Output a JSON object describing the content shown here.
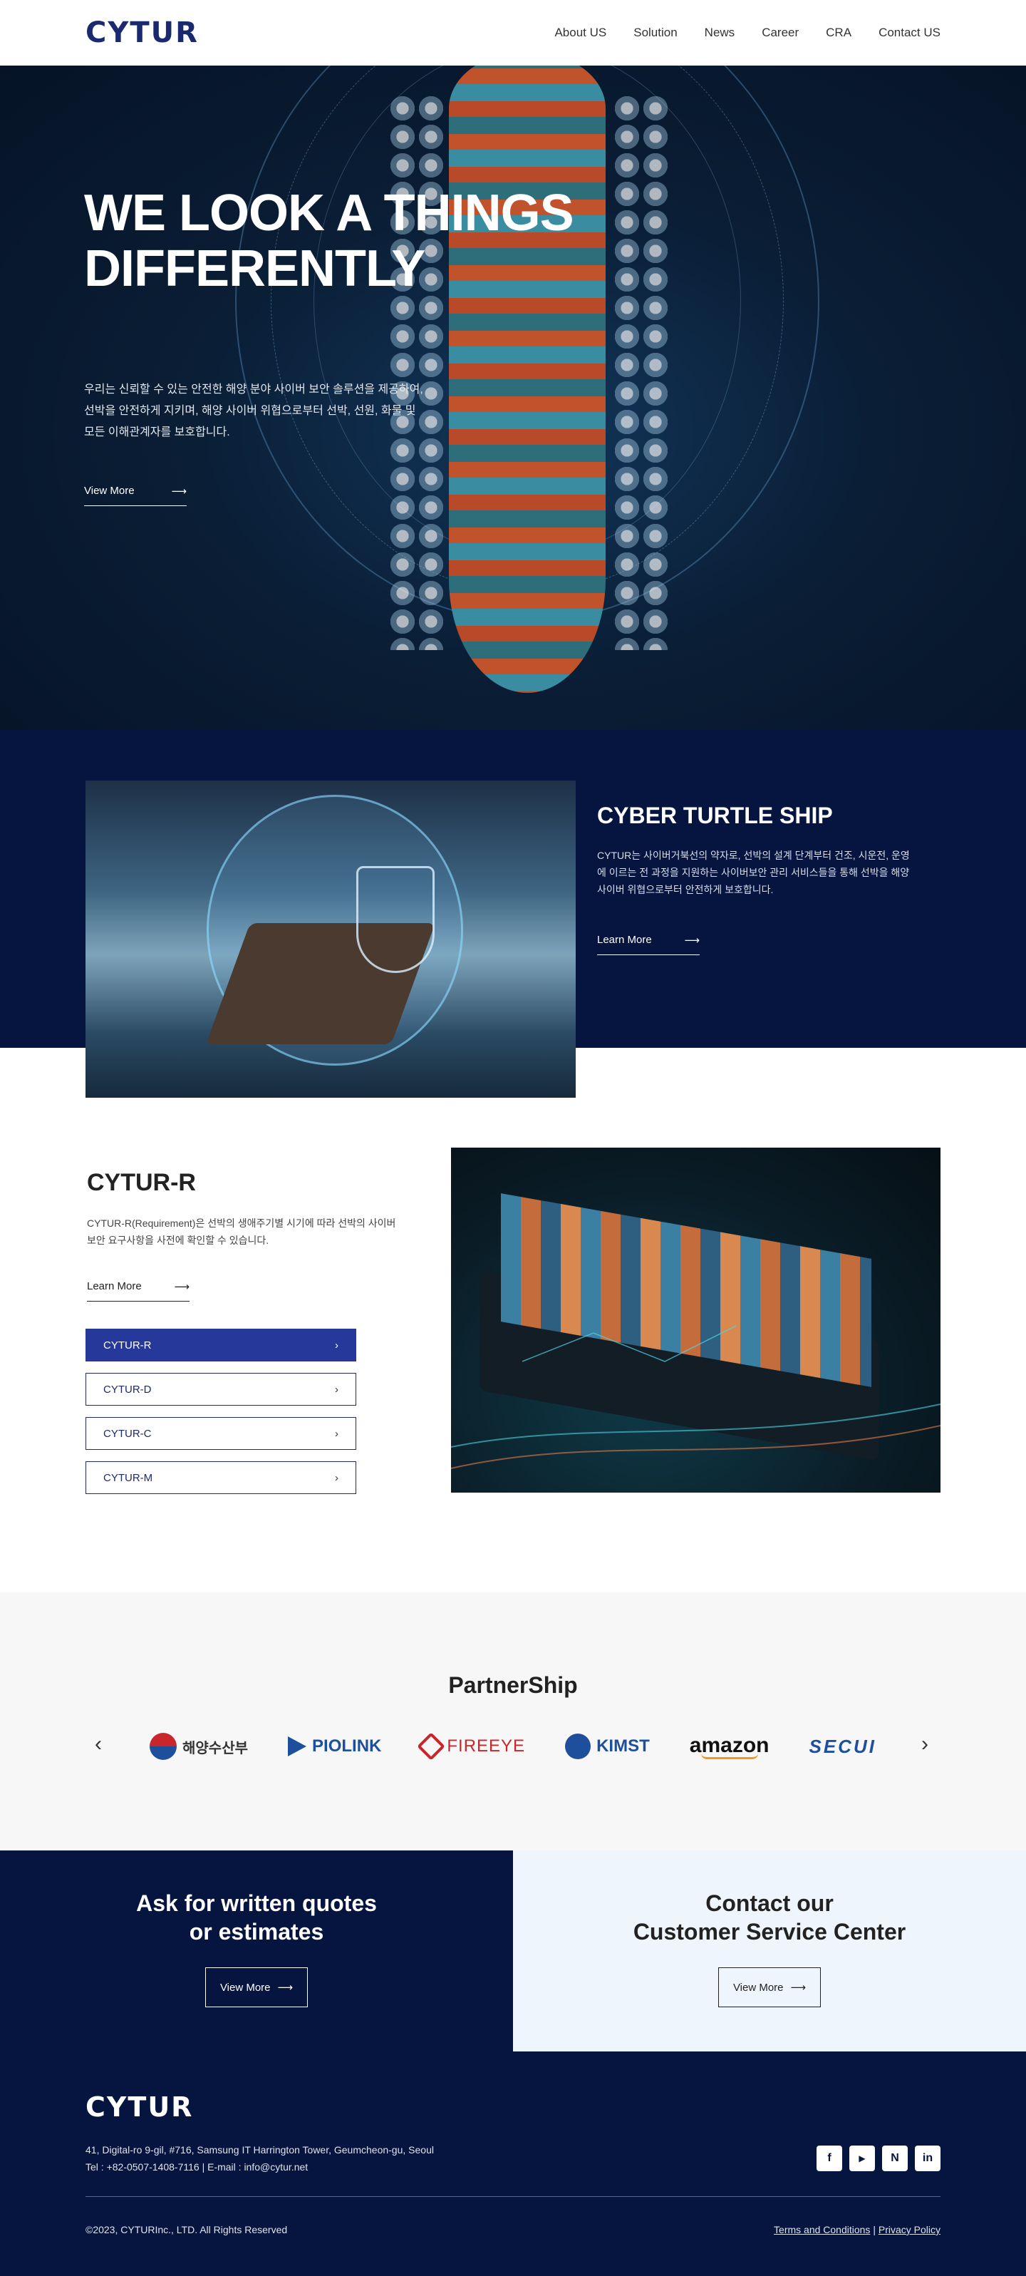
{
  "brand": {
    "logo_text": "CYTUR",
    "primary_color": "#051540",
    "accent_color": "#26389a"
  },
  "nav": {
    "items": [
      "About US",
      "Solution",
      "News",
      "Career",
      "CRA",
      "Contact US"
    ]
  },
  "hero": {
    "title_line1": "WE LOOK A THINGS",
    "title_line2": "DIFFERENTLY",
    "desc_line1": "우리는 신뢰할 수 있는 안전한 해양 분야 사이버 보안 솔루션을 제공하여,",
    "desc_line2": "선박을 안전하게 지키며, 해양 사이버 위협으로부터 선박, 선원, 화물 및",
    "desc_line3": "모든 이해관계자를 보호합니다.",
    "link_label": "View More",
    "link_arrow": "⟶"
  },
  "turtle": {
    "title": "CYBER TURTLE SHIP",
    "desc_line1": "CYTUR는 사이버거북선의 약자로, 선박의 설계 단계부터 건조, 시운전, 운영",
    "desc_line2": "에 이르는 전 과정을 지원하는 사이버보안 관리 서비스들을 통해 선박을 해양",
    "desc_line3": "사이버 위협으로부터 안전하게 보호합니다.",
    "link_label": "Learn More",
    "link_arrow": "⟶"
  },
  "cytur_r": {
    "title": "CYTUR-R",
    "desc_line1": "CYTUR-R(Requirement)은 선박의 생애주기별 시기에 따라 선박의 사이버",
    "desc_line2": "보안 요구사항을 사전에 확인할 수 있습니다.",
    "link_label": "Learn More",
    "link_arrow": "⟶",
    "buttons": [
      {
        "label": "CYTUR-R",
        "chevron": "›"
      },
      {
        "label": "CYTUR-D",
        "chevron": "›"
      },
      {
        "label": "CYTUR-C",
        "chevron": "›"
      },
      {
        "label": "CYTUR-M",
        "chevron": "›"
      }
    ],
    "selected": "CYTUR-R"
  },
  "partners": {
    "title": "PartnerShip",
    "prev_icon": "‹",
    "next_icon": "›",
    "logos": [
      {
        "text": "해양수산부",
        "color": "#333333"
      },
      {
        "text": "PIOLINK",
        "color": "#1d4f9c"
      },
      {
        "text": "FIREEYE",
        "color": "#c9262c"
      },
      {
        "text": "KIMST",
        "color": "#1d4f9c"
      },
      {
        "text": "amazon",
        "color": "#111111"
      },
      {
        "text": "SECUI",
        "color": "#1d4f9c"
      }
    ]
  },
  "cta": {
    "left_title_line1": "Ask for written quotes",
    "left_title_line2": "or estimates",
    "left_btn": "View More",
    "right_title_line1": "Contact our",
    "right_title_line2": "Customer Service Center",
    "right_btn": "View More",
    "arrow": "⟶"
  },
  "footer": {
    "logo_text": "CYTUR",
    "address": "41, Digital-ro 9-gil, #716, Samsung IT Harrington Tower, Geumcheon-gu, Seoul",
    "contact": "Tel : +82-0507-1408-7116 | E-mail : info@cytur.net",
    "copyright": "©2023, CYTURInc., LTD. All Rights Reserved",
    "terms": "Terms and Conditions",
    "separator": "|",
    "privacy": "Privacy Policy",
    "socials": [
      {
        "name": "facebook",
        "glyph": "f"
      },
      {
        "name": "youtube",
        "glyph": "▶"
      },
      {
        "name": "naver",
        "glyph": "N"
      },
      {
        "name": "linkedin",
        "glyph": "in"
      }
    ]
  }
}
